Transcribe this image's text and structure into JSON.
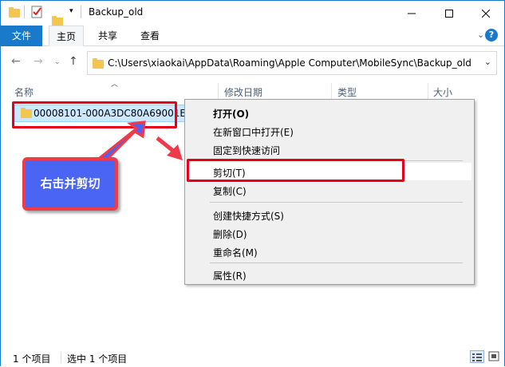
{
  "window": {
    "title": "Backup_old"
  },
  "ribbon": {
    "tabs": [
      "文件",
      "主页",
      "共享",
      "查看"
    ]
  },
  "address": {
    "path": "C:\\Users\\xiaokai\\AppData\\Roaming\\Apple Computer\\MobileSync\\Backup_old"
  },
  "columns": [
    "名称",
    "修改日期",
    "类型",
    "大小"
  ],
  "files": [
    {
      "name": "00008101-000A3DC80A69001E"
    }
  ],
  "context_menu": {
    "items": [
      "打开(O)",
      "在新窗口中打开(E)",
      "固定到快速访问",
      "剪切(T)",
      "复制(C)",
      "创建快捷方式(S)",
      "删除(D)",
      "重命名(M)",
      "属性(R)"
    ]
  },
  "callout": {
    "text": "右击并剪切"
  },
  "status": {
    "count": "1 个项目",
    "selected": "选中 1 个项目"
  },
  "colors": {
    "accent": "#1979ca",
    "highlight_red": "#e5001b",
    "callout_blue": "#4a64f4",
    "selection": "#cce8ff"
  },
  "icons": [
    "folder-icon",
    "properties-icon",
    "new-folder-icon",
    "dropdown-icon",
    "minimize-icon",
    "maximize-icon",
    "close-icon",
    "expand-ribbon-icon",
    "help-icon",
    "back-icon",
    "forward-icon",
    "recent-locations-icon",
    "up-icon",
    "address-dropdown-icon",
    "details-view-icon",
    "large-icons-view-icon"
  ]
}
